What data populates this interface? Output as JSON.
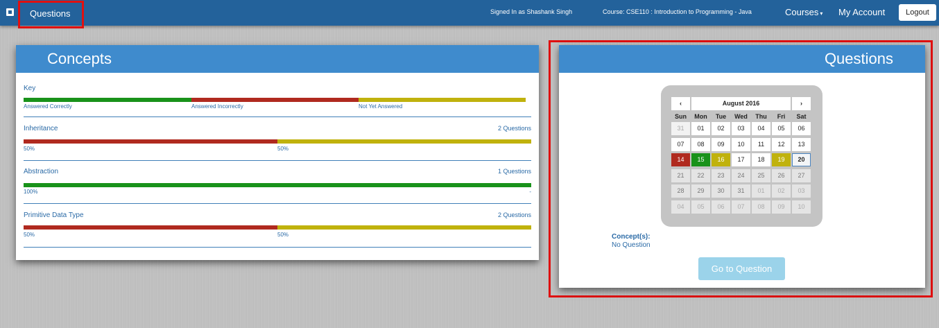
{
  "nav": {
    "questions_label": "Questions",
    "signed_in": "Signed In as Shashank Singh",
    "course": "Course: CSE110 : Introduction to Programming - Java",
    "courses_label": "Courses",
    "courses_caret": "▾",
    "account_label": "My Account",
    "logout_label": "Logout"
  },
  "concepts": {
    "title": "Concepts",
    "key": {
      "title": "Key",
      "correct": "Answered Correctly",
      "incorrect": "Answered Incorrectly",
      "not_yet": "Not Yet Answered"
    },
    "items": [
      {
        "name": "Inheritance",
        "count": "2 Questions",
        "incorrect_pct": 50,
        "not_yet_pct": 50,
        "label_a": "50%",
        "label_b": "50%"
      },
      {
        "name": "Abstraction",
        "count": "1 Questions",
        "correct_pct": 100,
        "label_a": "100%",
        "label_end": "-"
      },
      {
        "name": "Primitive Data Type",
        "count": "2 Questions",
        "incorrect_pct": 50,
        "not_yet_pct": 50,
        "label_a": "50%",
        "label_b": "50%"
      }
    ]
  },
  "questions": {
    "title": "Questions",
    "calendar": {
      "month": "August 2016",
      "prev_icon": "‹",
      "next_icon": "›",
      "dow": [
        "Sun",
        "Mon",
        "Tue",
        "Wed",
        "Thu",
        "Fri",
        "Sat"
      ],
      "weeks": [
        [
          "31",
          "01",
          "02",
          "03",
          "04",
          "05",
          "06"
        ],
        [
          "07",
          "08",
          "09",
          "10",
          "11",
          "12",
          "13"
        ],
        [
          "14",
          "15",
          "16",
          "17",
          "18",
          "19",
          "20"
        ],
        [
          "21",
          "22",
          "23",
          "24",
          "25",
          "26",
          "27"
        ],
        [
          "28",
          "29",
          "30",
          "31",
          "01",
          "02",
          "03"
        ],
        [
          "04",
          "05",
          "06",
          "07",
          "08",
          "09",
          "10"
        ]
      ]
    },
    "concepts_label": "Concept(s):",
    "concepts_value": "No Question",
    "goto_label": "Go to Question"
  },
  "colors": {
    "correct": "#19921a",
    "incorrect": "#b02a1f",
    "not_yet": "#c0b20d",
    "header": "#3f8bcd",
    "nav": "#23629b"
  }
}
